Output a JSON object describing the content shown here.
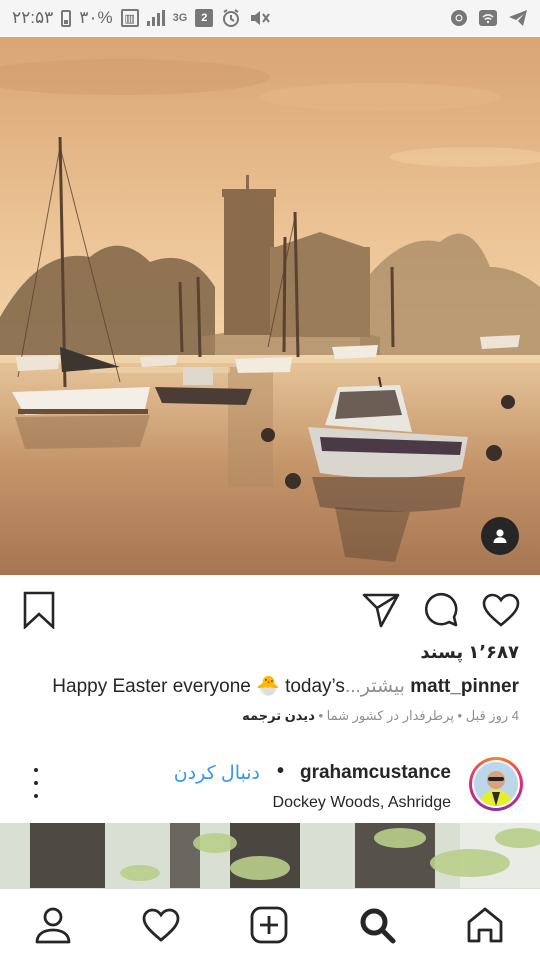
{
  "status_bar": {
    "time": "۲۲:۵۳",
    "battery": "۳۰%",
    "network": "3G",
    "sim_badge": "2"
  },
  "feed": {
    "post1": {
      "photo_icon": "person-tag-icon",
      "likes": "۱٬۶۸۷ پسند",
      "caption_user": "matt_pinner",
      "caption_text": "Happy Easter everyone 🐣 today’s",
      "more_label": "بیشتر...",
      "meta_time": "4 روز قبل • پرطرفدار در کشور شما • ",
      "meta_translate": "دیدن ترجمه"
    },
    "post2": {
      "username": "grahamcustance",
      "separator": "•",
      "follow_label": "دنبال کردن",
      "location": "Dockey Woods, Ashridge"
    }
  },
  "bottom_nav": {
    "items": [
      "home-icon",
      "search-icon",
      "new-post-icon",
      "activity-icon",
      "profile-icon"
    ]
  },
  "colors": {
    "accent_blue": "#3897f0",
    "text": "#262626",
    "secondary": "#8e8e8e"
  }
}
